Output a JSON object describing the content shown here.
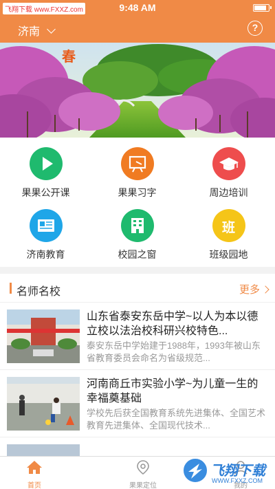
{
  "status_bar": {
    "source_tag": "飞翔下载 www.FXXZ.com",
    "time": "9:48 AM",
    "battery_level": 0.85
  },
  "nav": {
    "city": "济南",
    "help_icon": "question-circle-icon"
  },
  "banner": {
    "text": "春"
  },
  "grid": [
    {
      "label": "果果公开课",
      "icon": "play-icon",
      "color": "#1fba6e"
    },
    {
      "label": "果果习字",
      "icon": "board-icon",
      "color": "#f07b22"
    },
    {
      "label": "周边培训",
      "icon": "graduation-cap-icon",
      "color": "#ee4d4d"
    },
    {
      "label": "济南教育",
      "icon": "news-icon",
      "color": "#1fa6e8"
    },
    {
      "label": "校园之窗",
      "icon": "building-icon",
      "color": "#1fba6e"
    },
    {
      "label": "班级园地",
      "icon": "class-icon",
      "color": "#f5c518",
      "glyph": "班"
    }
  ],
  "section": {
    "title": "名师名校",
    "more_label": "更多"
  },
  "articles": [
    {
      "title": "山东省泰安东岳中学~以人为本以德立校以法治校科研兴校特色...",
      "desc": "泰安东岳中学始建于1988年，1993年被山东省教育委员会命名为省级规范..."
    },
    {
      "title": "河南商丘市实验小学~为儿童一生的幸福奠基础",
      "desc": "学校先后获全国教育系统先进集体、全国艺术教育先进集体、全国现代技术..."
    },
    {
      "title": "",
      "desc": ""
    }
  ],
  "tabbar": {
    "tabs": [
      {
        "label": "首页",
        "icon": "home-icon",
        "active": true
      },
      {
        "label": "果果定位",
        "icon": "location-icon",
        "active": false
      },
      {
        "label": "我的",
        "icon": "user-icon",
        "active": false
      }
    ]
  },
  "watermark": {
    "text": "飞翔下载",
    "url": "WWW.FXXZ.COM"
  },
  "colors": {
    "accent": "#f08a46",
    "tab_active": "#f08a46",
    "tab_inactive": "#999999"
  }
}
